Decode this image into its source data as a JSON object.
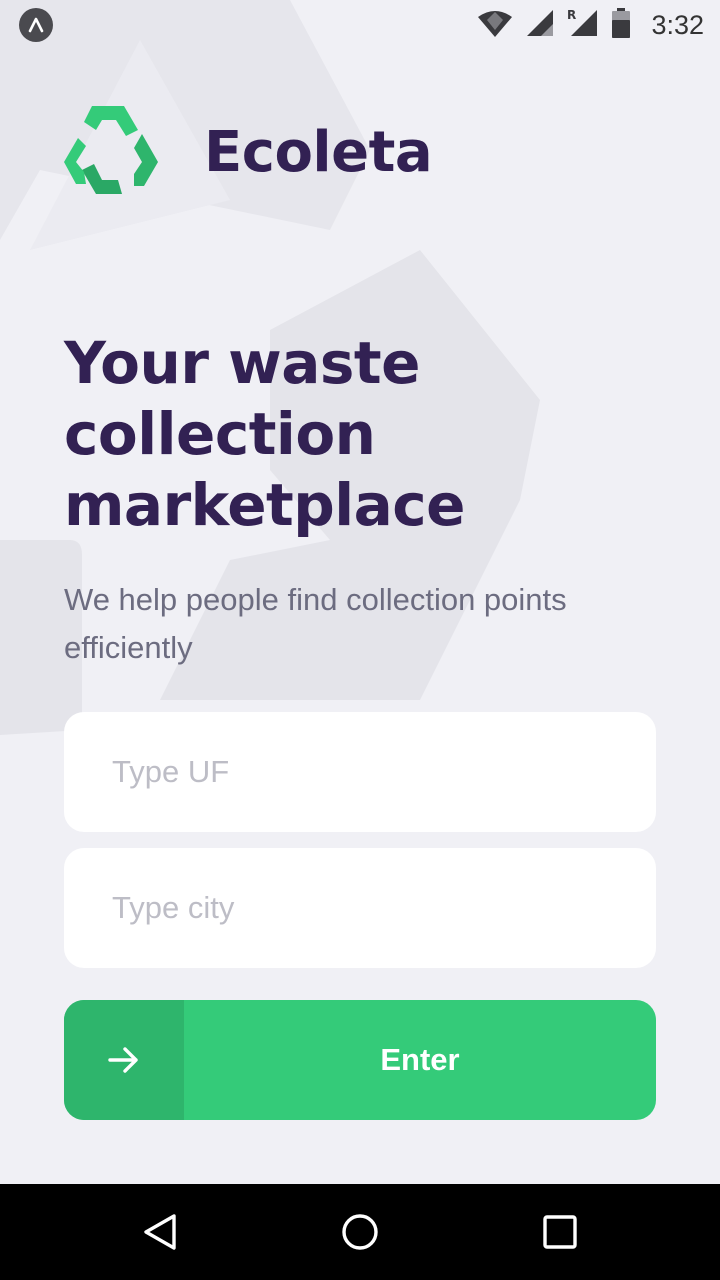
{
  "status_bar": {
    "time": "3:32",
    "icons": [
      "expo-icon",
      "wifi-icon",
      "signal-icon",
      "roaming-signal-icon",
      "battery-icon"
    ]
  },
  "brand": {
    "name": "Ecoleta",
    "logo_icon": "recycle-icon",
    "logo_color": "#34cb79"
  },
  "hero": {
    "title_lines": [
      "Your waste",
      "collection",
      "marketplace"
    ],
    "subtitle": "We help people find collection points efficiently"
  },
  "form": {
    "uf_placeholder": "Type UF",
    "uf_value": "",
    "city_placeholder": "Type city",
    "city_value": "",
    "enter_label": "Enter",
    "enter_icon": "arrow-right-icon"
  },
  "nav_bar": {
    "icons": [
      "back-triangle-icon",
      "home-circle-icon",
      "recents-square-icon"
    ]
  },
  "colors": {
    "background": "#f0f0f5",
    "title": "#322153",
    "text": "#6c6c80",
    "primary": "#34cb79",
    "primary_dark": "#2eb56c"
  }
}
